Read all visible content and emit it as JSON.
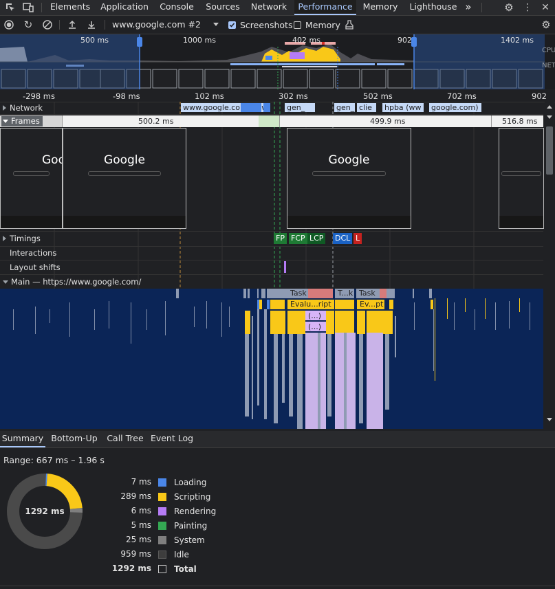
{
  "tabs": {
    "items": [
      "Elements",
      "Application",
      "Console",
      "Sources",
      "Network",
      "Performance",
      "Memory",
      "Lighthouse"
    ],
    "active": "Performance",
    "more": "»"
  },
  "toolbar": {
    "profile_select": "www.google.com #2",
    "screenshots_label": "Screenshots",
    "screenshots_checked": true,
    "memory_label": "Memory",
    "memory_checked": false
  },
  "overview": {
    "ticks": [
      "500 ms",
      "1000 ms",
      "902",
      "1402 ms"
    ],
    "cpu_label": "CPU",
    "net_label": "NET",
    "selection_label": "402 ms"
  },
  "ruler": {
    "ticks": [
      "-298 ms",
      "-98 ms",
      "102 ms",
      "302 ms",
      "502 ms",
      "702 ms",
      "902"
    ]
  },
  "tracks": {
    "network_label": "Network",
    "network_requests": [
      "www.google.com/ (ww",
      "gen_",
      "gen_",
      "clie",
      "hpba (ww",
      "google.com)"
    ],
    "frames_label": "Frames",
    "frame_durations": [
      "500.2 ms",
      "499.9 ms",
      "516.8 ms"
    ],
    "screenshot_logo": "Google",
    "timings_label": "Timings",
    "timing_markers": [
      "FP",
      "FCP",
      "LCP",
      "DCL",
      "L"
    ],
    "interactions_label": "Interactions",
    "layout_shifts_label": "Layout shifts",
    "main_label": "Main — https://www.google.com/",
    "main_blocks": [
      "Task",
      "Evalu...ript",
      "(...)",
      "(...)",
      "T...k",
      "Ev...pt",
      "Task"
    ]
  },
  "bottom_tabs": {
    "items": [
      "Summary",
      "Bottom-Up",
      "Call Tree",
      "Event Log"
    ],
    "active": "Summary"
  },
  "summary": {
    "range": "Range: 667 ms – 1.96 s",
    "total_center": "1292 ms",
    "rows": [
      {
        "value": "7 ms",
        "label": "Loading",
        "color": "#4a86e8"
      },
      {
        "value": "289 ms",
        "label": "Scripting",
        "color": "#f9c818"
      },
      {
        "value": "6 ms",
        "label": "Rendering",
        "color": "#b57cf5"
      },
      {
        "value": "5 ms",
        "label": "Painting",
        "color": "#34a853"
      },
      {
        "value": "25 ms",
        "label": "System",
        "color": "#7f7f7f"
      },
      {
        "value": "959 ms",
        "label": "Idle",
        "color": "#3d3d3d"
      }
    ],
    "total_value": "1292 ms",
    "total_label": "Total"
  }
}
